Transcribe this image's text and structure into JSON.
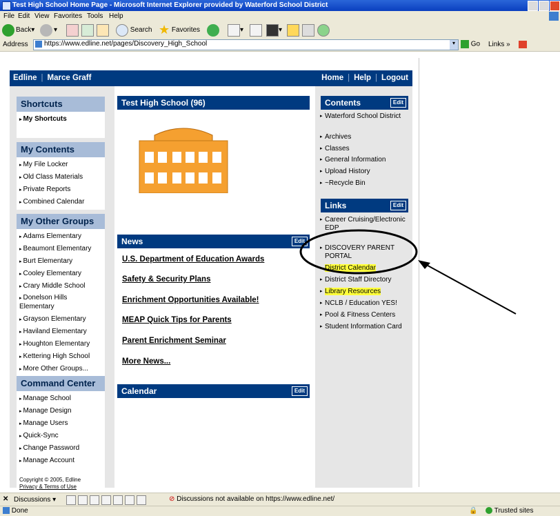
{
  "window": {
    "title": "Test High School Home Page - Microsoft Internet Explorer provided by Waterford School District"
  },
  "menu": [
    "File",
    "Edit",
    "View",
    "Favorites",
    "Tools",
    "Help"
  ],
  "toolbar": {
    "back": "Back",
    "search": "Search",
    "favorites": "Favorites"
  },
  "address": {
    "label": "Address",
    "url": "https://www.edline.net/pages/Discovery_High_School",
    "go": "Go",
    "links": "Links"
  },
  "header": {
    "left": [
      "Edline",
      "Marce Graff"
    ],
    "right": [
      "Home",
      "Help",
      "Logout"
    ]
  },
  "shortcuts": {
    "title": "Shortcuts",
    "items": [
      "My Shortcuts"
    ]
  },
  "my_contents": {
    "title": "My Contents",
    "items": [
      "My File Locker",
      "Old Class Materials",
      "Private Reports",
      "Combined Calendar"
    ]
  },
  "my_other_groups": {
    "title": "My Other Groups",
    "items": [
      "Adams Elementary",
      "Beaumont Elementary",
      "Burt Elementary",
      "Cooley Elementary",
      "Crary Middle School",
      "Donelson Hills Elementary",
      "Grayson Elementary",
      "Haviland Elementary",
      "Houghton Elementary",
      "Kettering High School",
      "More Other Groups..."
    ]
  },
  "command_center": {
    "title": "Command Center",
    "items": [
      "Manage School",
      "Manage Design",
      "Manage Users",
      "Quick-Sync",
      "Change Password",
      "Manage Account"
    ]
  },
  "footer": {
    "copyright": "Copyright © 2005, Edline",
    "privacy": "Privacy & Terms of Use"
  },
  "school": {
    "title": "Test High School (96)"
  },
  "news": {
    "title": "News",
    "edit": "Edit",
    "items": [
      "U.S. Department of Education Awards",
      "Safety & Security Plans",
      "Enrichment Opportunities Available!",
      "MEAP Quick Tips for Parents",
      "Parent Enrichment Seminar",
      "More News..."
    ]
  },
  "calendar": {
    "title": "Calendar",
    "edit": "Edit"
  },
  "contents": {
    "title": "Contents",
    "edit": "Edit",
    "items": [
      "Waterford School District",
      "Archives",
      "Classes",
      "General Information",
      "Upload History",
      "~Recycle Bin"
    ]
  },
  "links": {
    "title": "Links",
    "edit": "Edit",
    "items": [
      "Career Cruising/Electronic EDP",
      "DISCOVERY PARENT PORTAL",
      "District Calendar",
      "District Staff Directory",
      "Library Resources",
      "NCLB / Education YES!",
      "Pool & Fitness Centers",
      "Student Information Card"
    ]
  },
  "status": {
    "discussions": "Discussions",
    "discussions_msg": "Discussions not available on https://www.edline.net/",
    "done": "Done",
    "zone": "Trusted sites"
  },
  "colors": {
    "navy": "#003a80",
    "highlight": "#ffff3a",
    "building": "#f5a030"
  }
}
